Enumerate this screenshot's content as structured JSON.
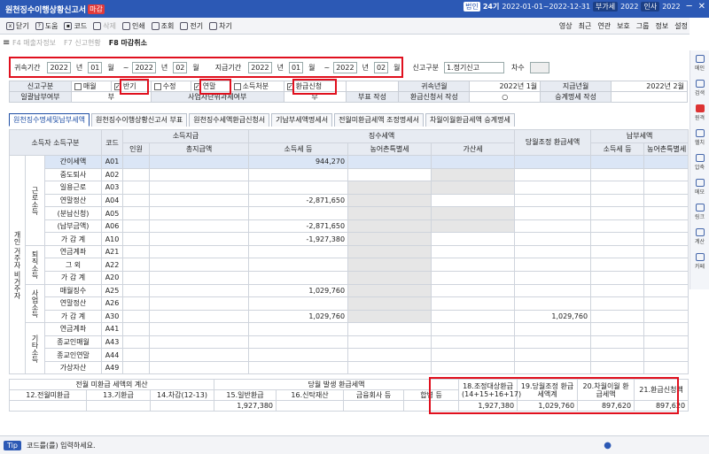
{
  "titlebar": {
    "title": "원천징수이행상황신고서",
    "badge": "마감",
    "law": "법인",
    "num": "24기",
    "period": "2022-01-01~2022-12-31",
    "btn1": "부가세",
    "year": "2022",
    "btn2": "인사",
    "year2": "2022"
  },
  "toolbar": {
    "items": [
      "닫기",
      "도움",
      "코드",
      "삭제",
      "인쇄",
      "조회",
      "전기",
      "차기"
    ],
    "right": [
      "영상",
      "최근",
      "연관",
      "보호",
      "그룹",
      "정보",
      "설정"
    ]
  },
  "menu2": {
    "f4": "F4 매출자정보",
    "f7": "F7 신고현황",
    "f8": "F8 마감취소"
  },
  "sidebar": [
    "메인",
    "검색",
    "원격",
    "헬치",
    "압축",
    "메모",
    "링크",
    "계산",
    "카페"
  ],
  "period": {
    "label1": "귀속기간",
    "y1": "2022",
    "m1": "01",
    "y2": "2022",
    "m2": "02",
    "label2": "지급기간",
    "y3": "2022",
    "m3": "01",
    "y4": "2022",
    "m4": "02",
    "nyear": "년",
    "month": "월",
    "tilde": "~",
    "type_label": "신고구분",
    "type_val": "1.정기신고",
    "cha": "차수"
  },
  "info": {
    "h1": "신고구분",
    "c1": "매월",
    "c2": "반기",
    "c3": "수정",
    "c4": "연말",
    "c5": "소득처분",
    "c6": "환급신청",
    "h2": "귀속년월",
    "v2": "2022년 1월",
    "h3": "지급년월",
    "v3": "2022년 2월",
    "r2a": "일괄납부여부",
    "r2b": "부",
    "r2c": "사업자단위과세여부",
    "r2d": "부",
    "r2e": "부표 작성",
    "r2f": "환급신청서 작성",
    "r2g": "○",
    "r2h": "승계명세 작성"
  },
  "tabs": [
    "원천징수명세및납부세액",
    "원천징수이행상황신고서 부표",
    "원천징수세액환급신청서",
    "기납부세액명세서",
    "전월미환급세액 조정명세서",
    "차월이월환급세액 승계명세"
  ],
  "main": {
    "h_income": "소득자 소득구분",
    "h_code": "코드",
    "h_pay": "소득지급",
    "h_tax": "징수세액",
    "h_adj": "당월조정 환급세액",
    "h_paid": "납부세액",
    "h_cnt": "인원",
    "h_amt": "총지급액",
    "h_itax": "소득세 등",
    "h_rural": "농어촌특별세",
    "h_add": "가산세",
    "group_main": "개인 거주자 비거주자",
    "g_earn": "근로소득",
    "g_ret": "퇴직소득",
    "g_bus": "사업소득",
    "g_etc": "기타소득",
    "rows": [
      {
        "name": "간이세액",
        "code": "A01",
        "itax": "944,270",
        "adj": ""
      },
      {
        "name": "중도퇴사",
        "code": "A02",
        "itax": "",
        "adj": ""
      },
      {
        "name": "일용근로",
        "code": "A03",
        "itax": "",
        "adj": ""
      },
      {
        "name": "연말정산",
        "code": "A04",
        "itax": "-2,871,650",
        "adj": ""
      },
      {
        "name": "(분납신청)",
        "code": "A05",
        "itax": "",
        "adj": ""
      },
      {
        "name": "(납부금액)",
        "code": "A06",
        "itax": "-2,871,650",
        "adj": ""
      },
      {
        "name": "가 감 계",
        "code": "A10",
        "itax": "-1,927,380",
        "adj": ""
      },
      {
        "name": "연금계좌",
        "code": "A21",
        "itax": "",
        "adj": ""
      },
      {
        "name": "그 외",
        "code": "A22",
        "itax": "",
        "adj": ""
      },
      {
        "name": "가 감 계",
        "code": "A20",
        "itax": "",
        "adj": ""
      },
      {
        "name": "매월징수",
        "code": "A25",
        "itax": "1,029,760",
        "adj": ""
      },
      {
        "name": "연말정산",
        "code": "A26",
        "itax": "",
        "adj": ""
      },
      {
        "name": "가 감 계",
        "code": "A30",
        "itax": "1,029,760",
        "adj": "1,029,760"
      },
      {
        "name": "연금계좌",
        "code": "A41",
        "itax": "",
        "adj": ""
      },
      {
        "name": "종교인매월",
        "code": "A43",
        "itax": "",
        "adj": ""
      },
      {
        "name": "종교인연말",
        "code": "A44",
        "itax": "",
        "adj": ""
      },
      {
        "name": "가상자산",
        "code": "A49",
        "itax": "",
        "adj": ""
      }
    ]
  },
  "bottom": {
    "h1": "전월 미환급 세액의 계산",
    "h2": "당월 발생 환급세액",
    "c12": "12.전월미환급",
    "c13": "13.기환급",
    "c14": "14.차감(12-13)",
    "c15": "15.일반환급",
    "c16": "16.신탁재산",
    "c17": "금융회사 등",
    "c17b": "합병 등",
    "c18": "18.조정대상환급(14+15+16+17)",
    "c19": "19.당월조정 환급세액계",
    "c20": "20.차월이월 환급세액",
    "c21": "21.환급신청액",
    "v15": "1,927,380",
    "v18": "1,927,380",
    "v19": "1,029,760",
    "v20": "897,620",
    "v21": "897,620"
  },
  "status": {
    "tip": "Tip",
    "msg": "코드를(를) 입력하세요."
  }
}
